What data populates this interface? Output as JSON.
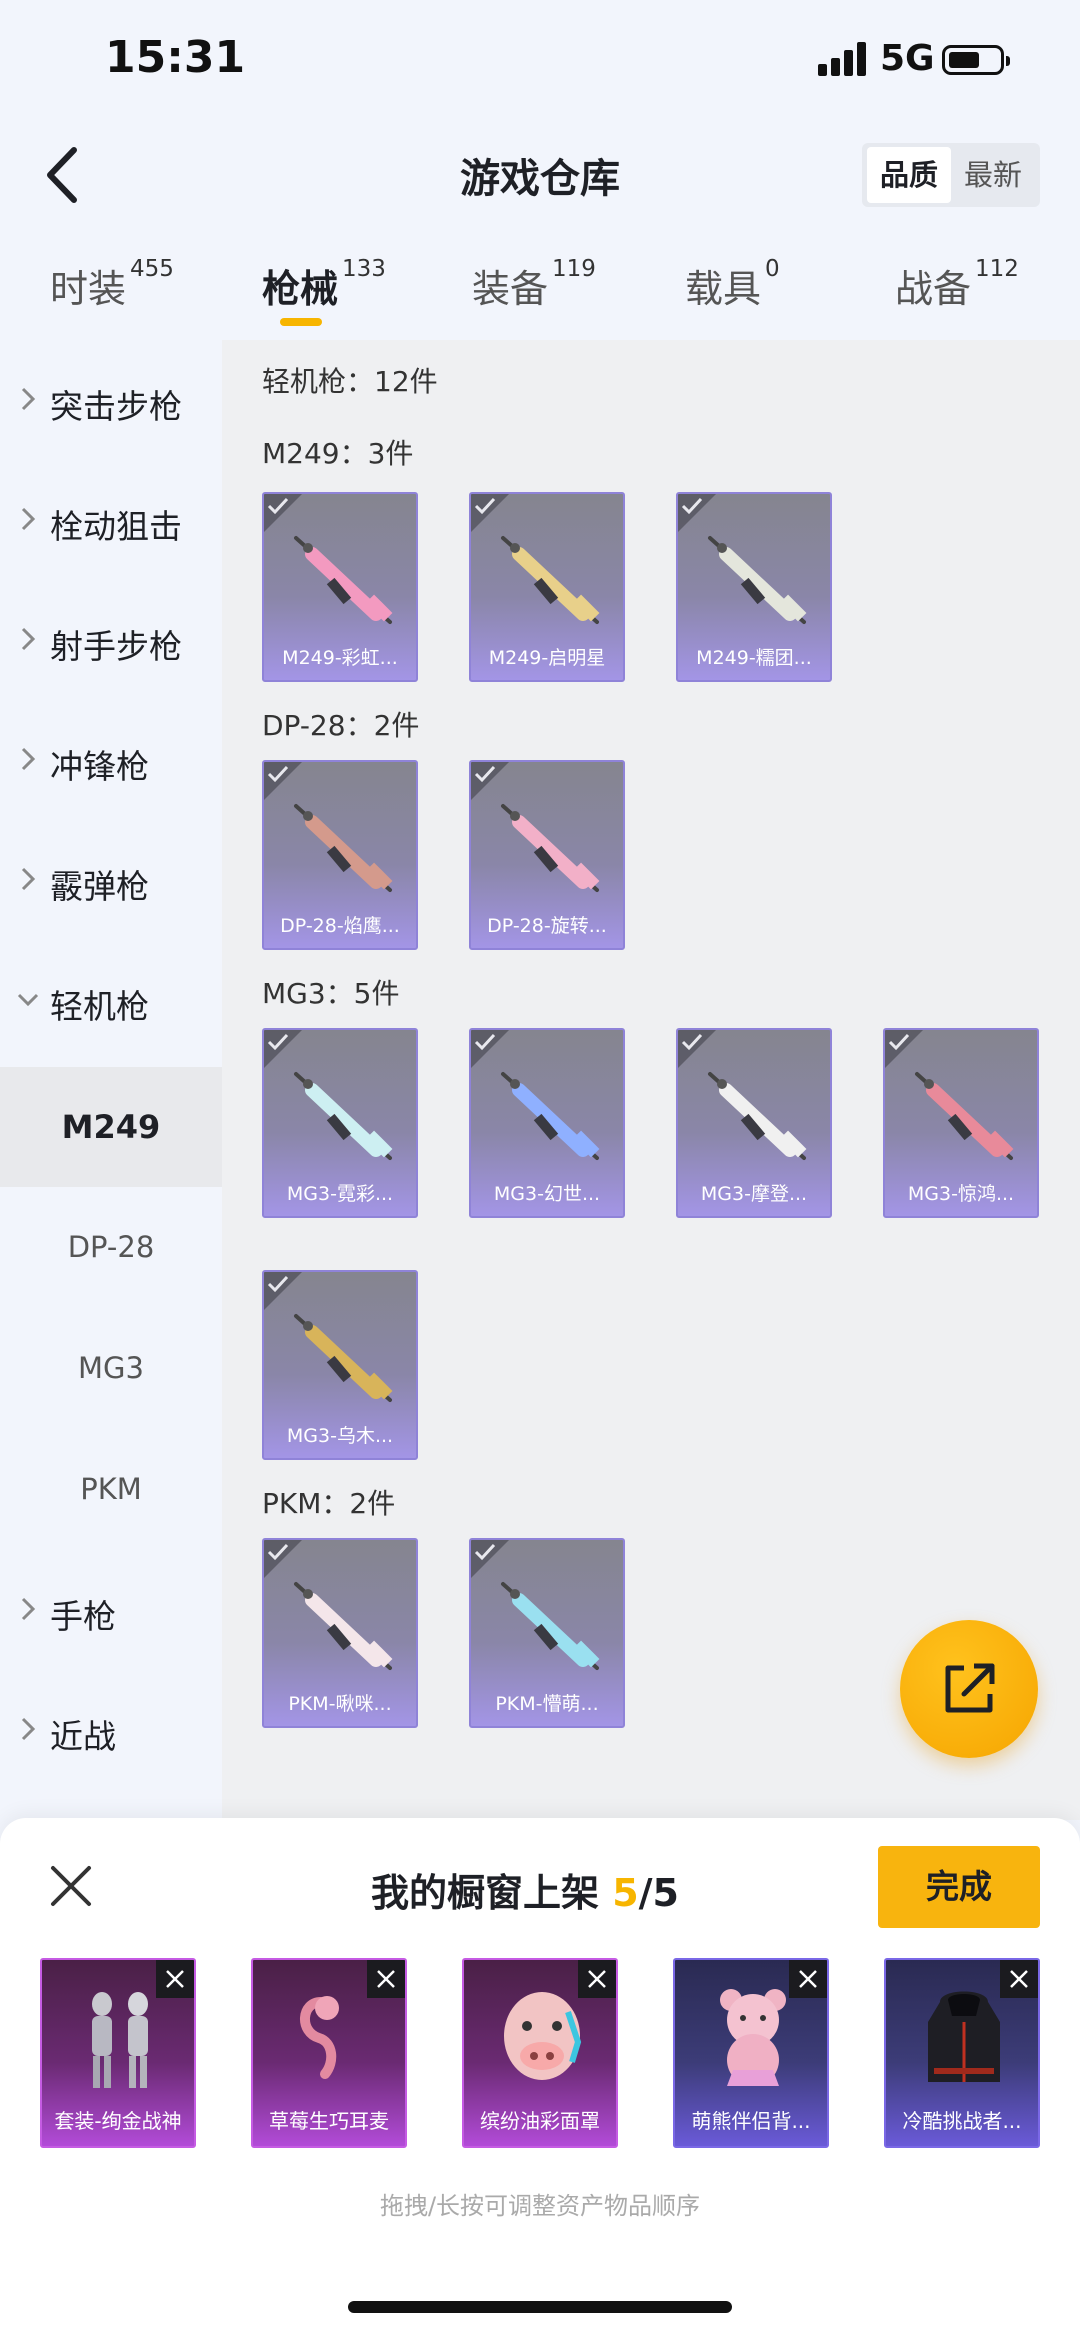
{
  "status": {
    "time": "15:31",
    "network": "5G"
  },
  "header": {
    "title": "游戏仓库",
    "sort_options": [
      "品质",
      "最新"
    ],
    "sort_active": "品质"
  },
  "tabs": [
    {
      "label": "时装",
      "count": "455",
      "active": false
    },
    {
      "label": "枪械",
      "count": "133",
      "active": true
    },
    {
      "label": "装备",
      "count": "119",
      "active": false
    },
    {
      "label": "载具",
      "count": "0",
      "active": false
    },
    {
      "label": "战备",
      "count": "112",
      "active": false
    }
  ],
  "sidebar": {
    "categories": [
      "突击步枪",
      "栓动狙击",
      "射手步枪",
      "冲锋枪",
      "霰弹枪",
      "轻机枪",
      "手枪",
      "近战"
    ],
    "expanded": "轻机枪",
    "subcategories": [
      "M249",
      "DP-28",
      "MG3",
      "PKM"
    ],
    "active_sub": "M249"
  },
  "content": {
    "summary": "轻机枪：12件",
    "groups": [
      {
        "title": "M249：3件",
        "items": [
          "M249-彩虹...",
          "M249-启明星",
          "M249-糯团..."
        ]
      },
      {
        "title": "DP-28：2件",
        "items": [
          "DP-28-焰鹰...",
          "DP-28-旋转..."
        ]
      },
      {
        "title": "MG3：5件",
        "items": [
          "MG3-霓彩...",
          "MG3-幻世...",
          "MG3-摩登...",
          "MG3-惊鸿...",
          "MG3-乌木..."
        ]
      },
      {
        "title": "PKM：2件",
        "items": [
          "PKM-啾咪...",
          "PKM-懵萌..."
        ]
      }
    ],
    "gun_colors": [
      "#f39ac0",
      "#e8d08a",
      "#e4e6dc",
      "#d49a8c",
      "#f2b0c8",
      "#cdeff2",
      "#8fb0ff",
      "#f0f0f0",
      "#e88a9a",
      "#d8b45a",
      "#f4e6ea",
      "#9ae0f0"
    ]
  },
  "panel": {
    "title_prefix": "我的橱窗上架 ",
    "count": "5",
    "total": "/5",
    "done_label": "完成",
    "items": [
      {
        "label": "套装-绚金战神",
        "style": "pink"
      },
      {
        "label": "草莓生巧耳麦",
        "style": "pink"
      },
      {
        "label": "缤纷油彩面罩",
        "style": "pink"
      },
      {
        "label": "萌熊伴侣背...",
        "style": "blue"
      },
      {
        "label": "冷酷挑战者...",
        "style": "blue"
      }
    ],
    "hint": "拖拽/长按可调整资产物品顺序"
  }
}
